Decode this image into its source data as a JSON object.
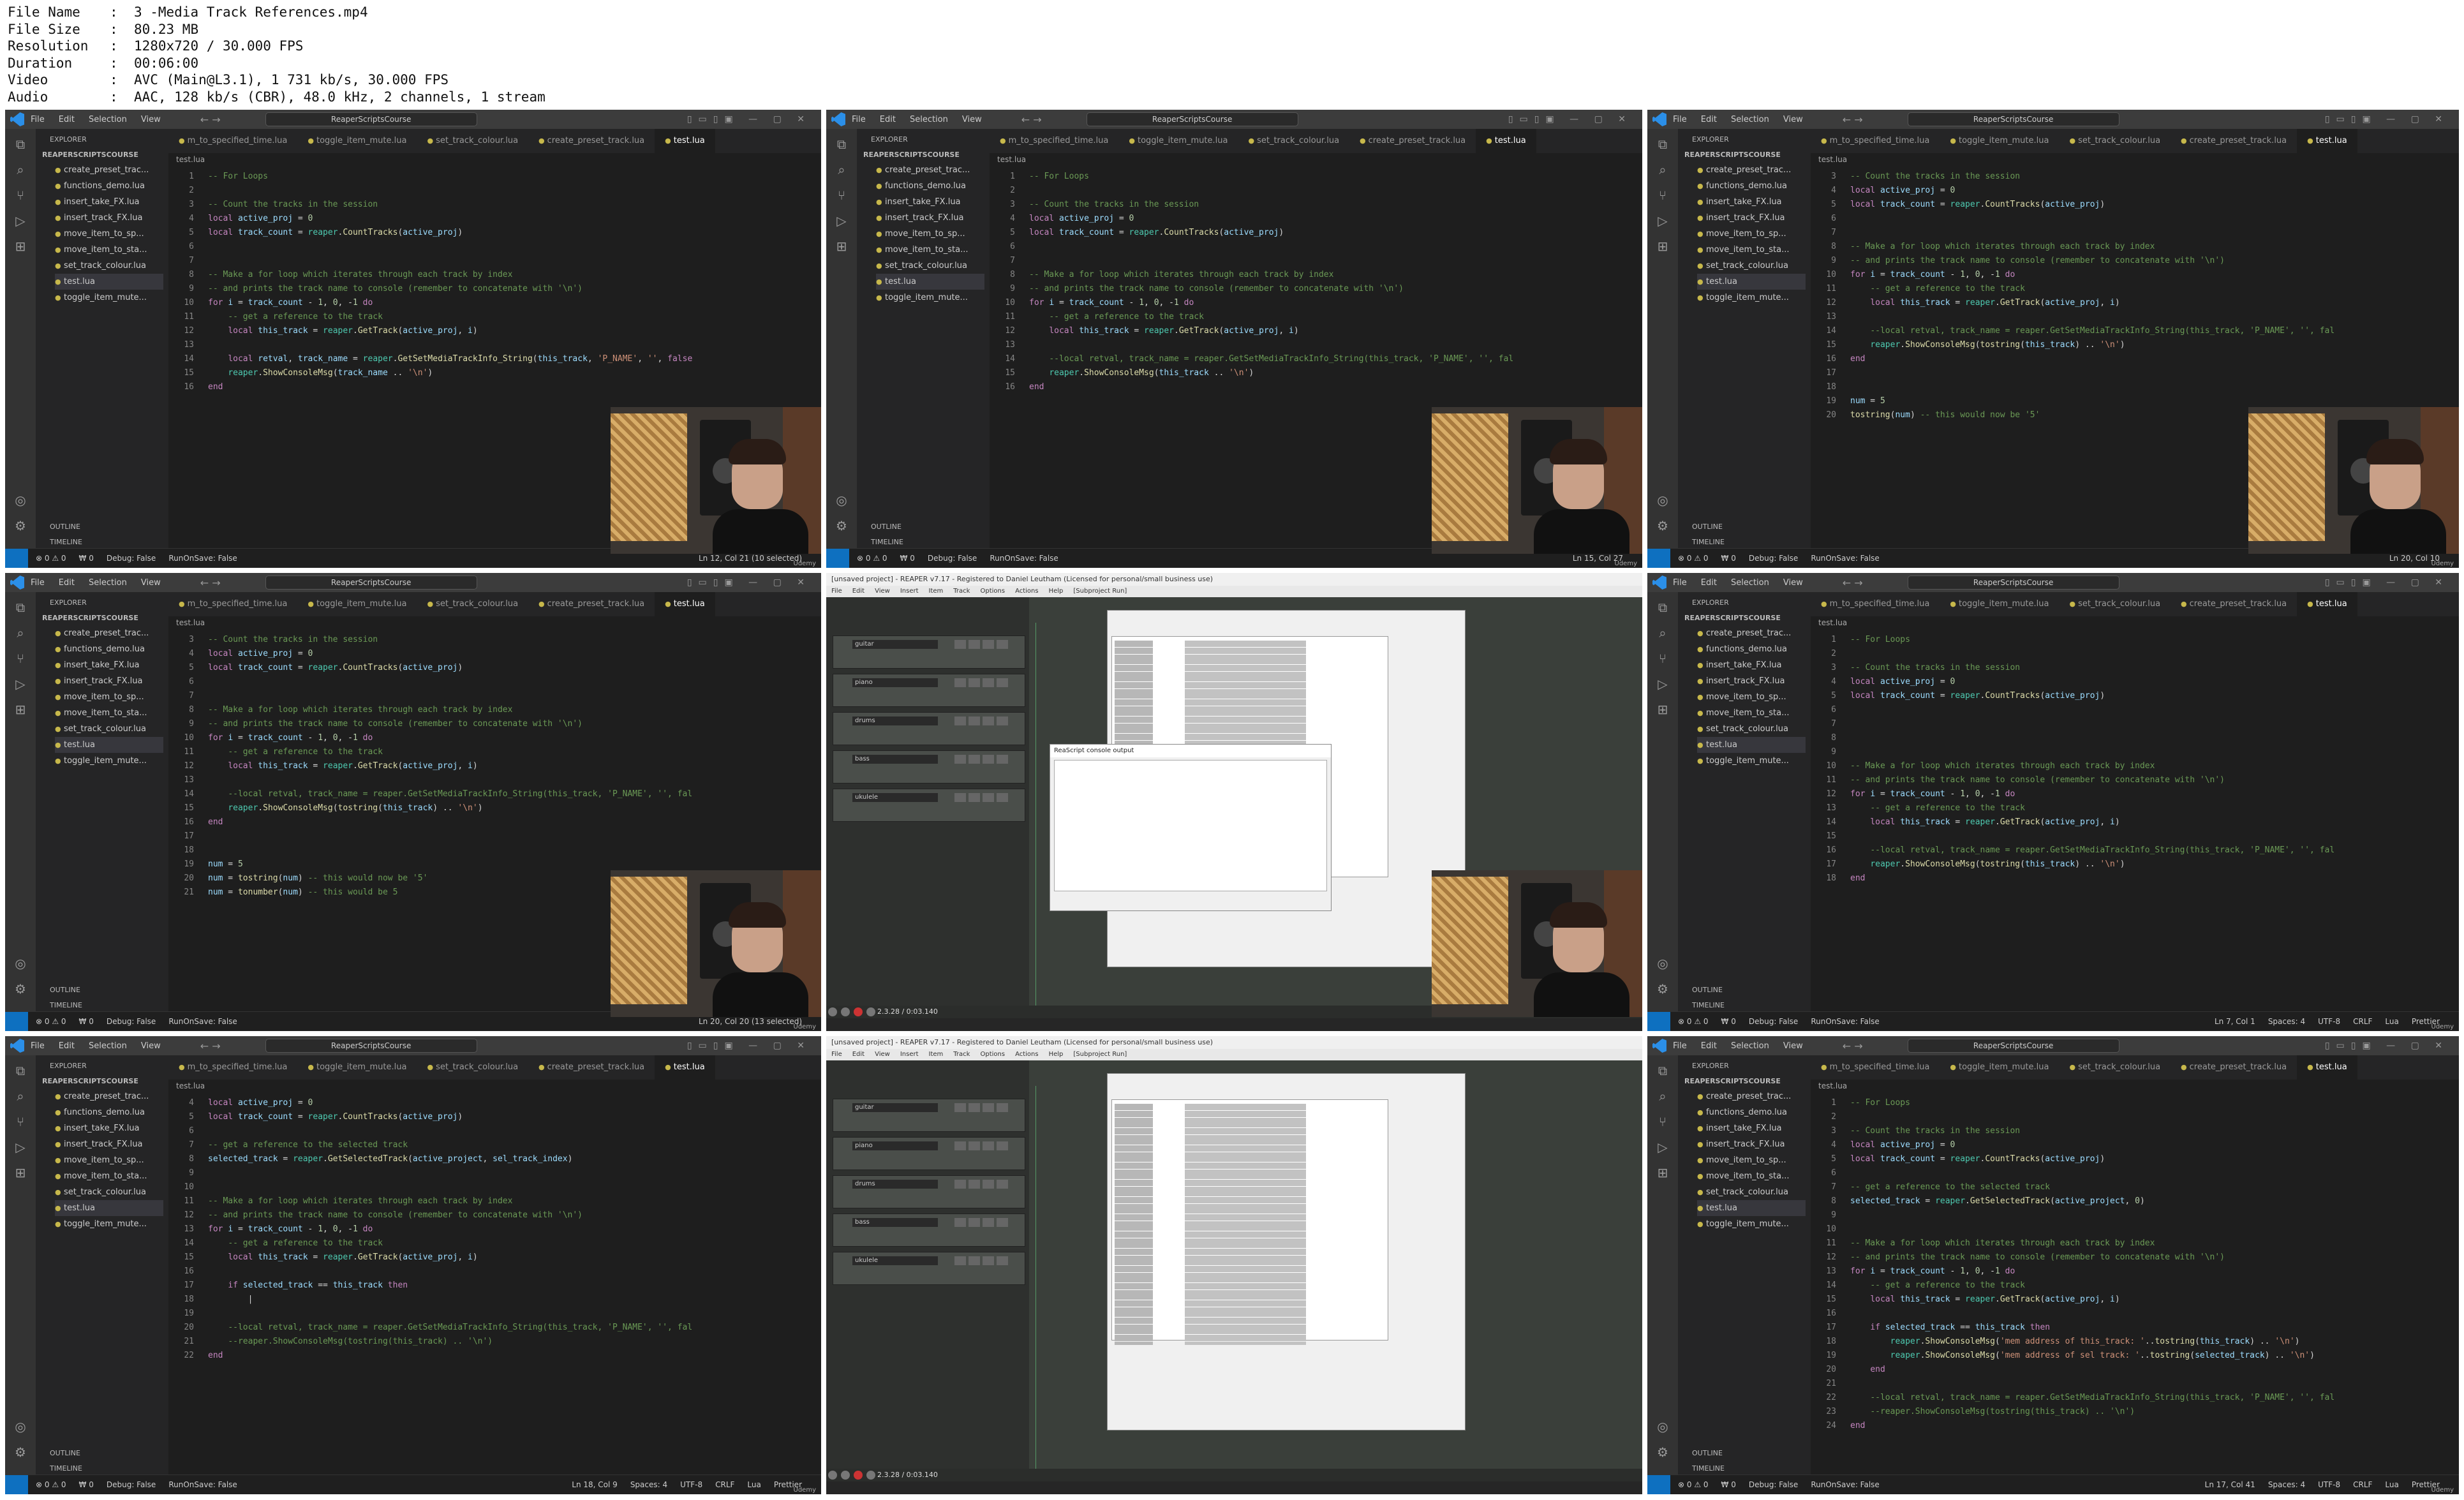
{
  "header": [
    {
      "k": "File Name",
      "v": "3 -Media Track References.mp4"
    },
    {
      "k": "File Size",
      "v": "80.23 MB"
    },
    {
      "k": "Resolution",
      "v": "1280x720 / 30.000 FPS"
    },
    {
      "k": "Duration",
      "v": "00:06:00"
    },
    {
      "k": "Video",
      "v": "AVC (Main@L3.1), 1 731 kb/s, 30.000 FPS"
    },
    {
      "k": "Audio",
      "v": "AAC, 128 kb/s (CBR), 48.0 kHz, 2 channels, 1 stream"
    }
  ],
  "vscode": {
    "menu": [
      "File",
      "Edit",
      "Selection",
      "View"
    ],
    "nav": "← →",
    "search": "ReaperScriptsCourse",
    "explorer": "EXPLORER",
    "workspace": "REAPERSCRIPTSCOURSE",
    "files": [
      "create_preset_trac...",
      "functions_demo.lua",
      "insert_take_FX.lua",
      "insert_track_FX.lua",
      "move_item_to_sp...",
      "move_item_to_sta...",
      "set_track_colour.lua",
      "test.lua",
      "toggle_item_mute..."
    ],
    "tabs": [
      "m_to_specified_time.lua",
      "toggle_item_mute.lua",
      "set_track_colour.lua",
      "create_preset_track.lua",
      "test.lua"
    ],
    "breadcrumb": "test.lua",
    "outline": "OUTLINE",
    "timeline": "TIMELINE",
    "status": {
      "errors": "⊗ 0 ⚠ 0",
      "ports": "₩ 0",
      "debug": "Debug: False",
      "run": "RunOnSave: False"
    },
    "udemy": "Udemy"
  },
  "reaper": {
    "title": "[unsaved project] - REAPER v7.17 - Registered to Daniel Leutham (Licensed for personal/small business use)",
    "menu": [
      "File",
      "Edit",
      "View",
      "Insert",
      "Item",
      "Track",
      "Options",
      "Actions",
      "Help",
      "[Subproject Run]"
    ],
    "tracks": [
      "guitar",
      "piano",
      "drums",
      "bass",
      "ukulele"
    ],
    "console_title": "ReaScript console output",
    "time": "2.3.28 / 0:03.140"
  },
  "tiles": [
    {
      "kind": "vscode",
      "cursor": "Ln 12, Col 21 (10 selected)",
      "cam": true,
      "lines": [
        {
          "n": "1",
          "t": "-- For Loops",
          "c": "c"
        },
        {
          "n": "2",
          "t": ""
        },
        {
          "n": "3",
          "t": "-- Count the tracks in the session",
          "c": "c"
        },
        {
          "n": "4",
          "t": "local active_proj = 0"
        },
        {
          "n": "5",
          "t": "local track_count = reaper.CountTracks(active_proj)"
        },
        {
          "n": "6",
          "t": ""
        },
        {
          "n": "7",
          "t": ""
        },
        {
          "n": "8",
          "t": "-- Make a for loop which iterates through each track by index",
          "c": "c"
        },
        {
          "n": "9",
          "t": "-- and prints the track name to console (remember to concatenate with '\\n')",
          "c": "c"
        },
        {
          "n": "10",
          "t": "for i = track_count - 1, 0, -1 do"
        },
        {
          "n": "11",
          "t": "    -- get a reference to the track",
          "c": "c"
        },
        {
          "n": "12",
          "t": "    local this_track = reaper.GetTrack(active_proj, i)"
        },
        {
          "n": "13",
          "t": ""
        },
        {
          "n": "14",
          "t": "    local retval, track_name = reaper.GetSetMediaTrackInfo_String(this_track, 'P_NAME', '', false"
        },
        {
          "n": "15",
          "t": "    reaper.ShowConsoleMsg(track_name .. '\\n')"
        },
        {
          "n": "16",
          "t": "end"
        }
      ]
    },
    {
      "kind": "vscode",
      "cursor": "Ln 15, Col 27",
      "cam": true,
      "lines": [
        {
          "n": "1",
          "t": "-- For Loops",
          "c": "c"
        },
        {
          "n": "2",
          "t": ""
        },
        {
          "n": "3",
          "t": "-- Count the tracks in the session",
          "c": "c"
        },
        {
          "n": "4",
          "t": "local active_proj = 0"
        },
        {
          "n": "5",
          "t": "local track_count = reaper.CountTracks(active_proj)"
        },
        {
          "n": "6",
          "t": ""
        },
        {
          "n": "7",
          "t": ""
        },
        {
          "n": "8",
          "t": "-- Make a for loop which iterates through each track by index",
          "c": "c"
        },
        {
          "n": "9",
          "t": "-- and prints the track name to console (remember to concatenate with '\\n')",
          "c": "c"
        },
        {
          "n": "10",
          "t": "for i = track_count - 1, 0, -1 do"
        },
        {
          "n": "11",
          "t": "    -- get a reference to the track",
          "c": "c"
        },
        {
          "n": "12",
          "t": "    local this_track = reaper.GetTrack(active_proj, i)"
        },
        {
          "n": "13",
          "t": ""
        },
        {
          "n": "14",
          "t": "    --local retval, track_name = reaper.GetSetMediaTrackInfo_String(this_track, 'P_NAME', '', fal",
          "c": "c"
        },
        {
          "n": "15",
          "t": "    reaper.ShowConsoleMsg(this_track .. '\\n')"
        },
        {
          "n": "16",
          "t": "end"
        }
      ]
    },
    {
      "kind": "vscode",
      "cursor": "Ln 20, Col 10",
      "cam": true,
      "lines": [
        {
          "n": "3",
          "t": "-- Count the tracks in the session",
          "c": "c"
        },
        {
          "n": "4",
          "t": "local active_proj = 0"
        },
        {
          "n": "5",
          "t": "local track_count = reaper.CountTracks(active_proj)"
        },
        {
          "n": "6",
          "t": ""
        },
        {
          "n": "7",
          "t": ""
        },
        {
          "n": "8",
          "t": "-- Make a for loop which iterates through each track by index",
          "c": "c"
        },
        {
          "n": "9",
          "t": "-- and prints the track name to console (remember to concatenate with '\\n')",
          "c": "c"
        },
        {
          "n": "10",
          "t": "for i = track_count - 1, 0, -1 do"
        },
        {
          "n": "11",
          "t": "    -- get a reference to the track",
          "c": "c"
        },
        {
          "n": "12",
          "t": "    local this_track = reaper.GetTrack(active_proj, i)"
        },
        {
          "n": "13",
          "t": ""
        },
        {
          "n": "14",
          "t": "    --local retval, track_name = reaper.GetSetMediaTrackInfo_String(this_track, 'P_NAME', '', fal",
          "c": "c"
        },
        {
          "n": "15",
          "t": "    reaper.ShowConsoleMsg(tostring(this_track) .. '\\n')"
        },
        {
          "n": "16",
          "t": "end"
        },
        {
          "n": "17",
          "t": ""
        },
        {
          "n": "18",
          "t": ""
        },
        {
          "n": "19",
          "t": "num = 5"
        },
        {
          "n": "20",
          "t": "tostring(num) -- this would now be '5'"
        }
      ]
    },
    {
      "kind": "vscode",
      "cursor": "Ln 20, Col 20 (13 selected)",
      "cam": true,
      "lines": [
        {
          "n": "3",
          "t": "-- Count the tracks in the session",
          "c": "c"
        },
        {
          "n": "4",
          "t": "local active_proj = 0"
        },
        {
          "n": "5",
          "t": "local track_count = reaper.CountTracks(active_proj)"
        },
        {
          "n": "6",
          "t": ""
        },
        {
          "n": "7",
          "t": ""
        },
        {
          "n": "8",
          "t": "-- Make a for loop which iterates through each track by index",
          "c": "c"
        },
        {
          "n": "9",
          "t": "-- and prints the track name to console (remember to concatenate with '\\n')",
          "c": "c"
        },
        {
          "n": "10",
          "t": "for i = track_count - 1, 0, -1 do"
        },
        {
          "n": "11",
          "t": "    -- get a reference to the track",
          "c": "c"
        },
        {
          "n": "12",
          "t": "    local this_track = reaper.GetTrack(active_proj, i)"
        },
        {
          "n": "13",
          "t": ""
        },
        {
          "n": "14",
          "t": "    --local retval, track_name = reaper.GetSetMediaTrackInfo_String(this_track, 'P_NAME', '', fal",
          "c": "c"
        },
        {
          "n": "15",
          "t": "    reaper.ShowConsoleMsg(tostring(this_track) .. '\\n')"
        },
        {
          "n": "16",
          "t": "end"
        },
        {
          "n": "17",
          "t": ""
        },
        {
          "n": "18",
          "t": ""
        },
        {
          "n": "19",
          "t": "num = 5"
        },
        {
          "n": "20",
          "t": "num = tostring(num) -- this would now be '5'"
        },
        {
          "n": "21",
          "t": "num = tonumber(num) -- this would be 5"
        }
      ]
    },
    {
      "kind": "reaper",
      "cam": true,
      "console": true
    },
    {
      "kind": "vscode",
      "cursor": "Ln 7, Col 1",
      "cam": false,
      "extra": [
        "Spaces: 4",
        "UTF-8",
        "CRLF",
        "Lua",
        "Prettier"
      ],
      "lines": [
        {
          "n": "1",
          "t": "-- For Loops",
          "c": "c"
        },
        {
          "n": "2",
          "t": ""
        },
        {
          "n": "3",
          "t": "-- Count the tracks in the session",
          "c": "c"
        },
        {
          "n": "4",
          "t": "local active_proj = 0"
        },
        {
          "n": "5",
          "t": "local track_count = reaper.CountTracks(active_proj)"
        },
        {
          "n": "6",
          "t": ""
        },
        {
          "n": "7",
          "t": ""
        },
        {
          "n": "8",
          "t": ""
        },
        {
          "n": "9",
          "t": ""
        },
        {
          "n": "10",
          "t": "-- Make a for loop which iterates through each track by index",
          "c": "c"
        },
        {
          "n": "11",
          "t": "-- and prints the track name to console (remember to concatenate with '\\n')",
          "c": "c"
        },
        {
          "n": "12",
          "t": "for i = track_count - 1, 0, -1 do"
        },
        {
          "n": "13",
          "t": "    -- get a reference to the track",
          "c": "c"
        },
        {
          "n": "14",
          "t": "    local this_track = reaper.GetTrack(active_proj, i)"
        },
        {
          "n": "15",
          "t": ""
        },
        {
          "n": "16",
          "t": "    --local retval, track_name = reaper.GetSetMediaTrackInfo_String(this_track, 'P_NAME', '', fal",
          "c": "c"
        },
        {
          "n": "17",
          "t": "    reaper.ShowConsoleMsg(tostring(this_track) .. '\\n')"
        },
        {
          "n": "18",
          "t": "end"
        }
      ]
    },
    {
      "kind": "vscode",
      "cursor": "Ln 18, Col 9",
      "cam": false,
      "extra": [
        "Spaces: 4",
        "UTF-8",
        "CRLF",
        "Lua",
        "Prettier"
      ],
      "lines": [
        {
          "n": "4",
          "t": "local active_proj = 0"
        },
        {
          "n": "5",
          "t": "local track_count = reaper.CountTracks(active_proj)"
        },
        {
          "n": "6",
          "t": ""
        },
        {
          "n": "7",
          "t": "-- get a reference to the selected track",
          "c": "c"
        },
        {
          "n": "8",
          "t": "selected_track = reaper.GetSelectedTrack(active_project, sel_track_index)"
        },
        {
          "n": "9",
          "t": ""
        },
        {
          "n": "10",
          "t": ""
        },
        {
          "n": "11",
          "t": "-- Make a for loop which iterates through each track by index",
          "c": "c"
        },
        {
          "n": "12",
          "t": "-- and prints the track name to console (remember to concatenate with '\\n')",
          "c": "c"
        },
        {
          "n": "13",
          "t": "for i = track_count - 1, 0, -1 do"
        },
        {
          "n": "14",
          "t": "    -- get a reference to the track",
          "c": "c"
        },
        {
          "n": "15",
          "t": "    local this_track = reaper.GetTrack(active_proj, i)"
        },
        {
          "n": "16",
          "t": ""
        },
        {
          "n": "17",
          "t": "    if selected_track == this_track then"
        },
        {
          "n": "18",
          "t": "        |"
        },
        {
          "n": "19",
          "t": ""
        },
        {
          "n": "20",
          "t": "    --local retval, track_name = reaper.GetSetMediaTrackInfo_String(this_track, 'P_NAME', '', fal",
          "c": "c"
        },
        {
          "n": "21",
          "t": "    --reaper.ShowConsoleMsg(tostring(this_track) .. '\\n')",
          "c": "c"
        },
        {
          "n": "22",
          "t": "end"
        }
      ]
    },
    {
      "kind": "reaper",
      "cam": false,
      "console": false
    },
    {
      "kind": "vscode",
      "cursor": "Ln 17, Col 41",
      "cam": false,
      "extra": [
        "Spaces: 4",
        "UTF-8",
        "CRLF",
        "Lua",
        "Prettier"
      ],
      "lines": [
        {
          "n": "1",
          "t": "-- For Loops",
          "c": "c"
        },
        {
          "n": "2",
          "t": ""
        },
        {
          "n": "3",
          "t": "-- Count the tracks in the session",
          "c": "c"
        },
        {
          "n": "4",
          "t": "local active_proj = 0"
        },
        {
          "n": "5",
          "t": "local track_count = reaper.CountTracks(active_proj)"
        },
        {
          "n": "6",
          "t": ""
        },
        {
          "n": "7",
          "t": "-- get a reference to the selected track",
          "c": "c"
        },
        {
          "n": "8",
          "t": "selected_track = reaper.GetSelectedTrack(active_project, 0)"
        },
        {
          "n": "9",
          "t": ""
        },
        {
          "n": "10",
          "t": ""
        },
        {
          "n": "11",
          "t": "-- Make a for loop which iterates through each track by index",
          "c": "c"
        },
        {
          "n": "12",
          "t": "-- and prints the track name to console (remember to concatenate with '\\n')",
          "c": "c"
        },
        {
          "n": "13",
          "t": "for i = track_count - 1, 0, -1 do"
        },
        {
          "n": "14",
          "t": "    -- get a reference to the track",
          "c": "c"
        },
        {
          "n": "15",
          "t": "    local this_track = reaper.GetTrack(active_proj, i)"
        },
        {
          "n": "16",
          "t": ""
        },
        {
          "n": "17",
          "t": "    if selected_track == this_track then"
        },
        {
          "n": "18",
          "t": "        reaper.ShowConsoleMsg('mem address of this_track: '..tostring(this_track) .. '\\n')"
        },
        {
          "n": "19",
          "t": "        reaper.ShowConsoleMsg('mem address of sel track: '..tostring(selected_track) .. '\\n')"
        },
        {
          "n": "20",
          "t": "    end"
        },
        {
          "n": "21",
          "t": ""
        },
        {
          "n": "22",
          "t": "    --local retval, track_name = reaper.GetSetMediaTrackInfo_String(this_track, 'P_NAME', '', fal",
          "c": "c"
        },
        {
          "n": "23",
          "t": "    --reaper.ShowConsoleMsg(tostring(this_track) .. '\\n')",
          "c": "c"
        },
        {
          "n": "24",
          "t": "end"
        }
      ]
    }
  ]
}
